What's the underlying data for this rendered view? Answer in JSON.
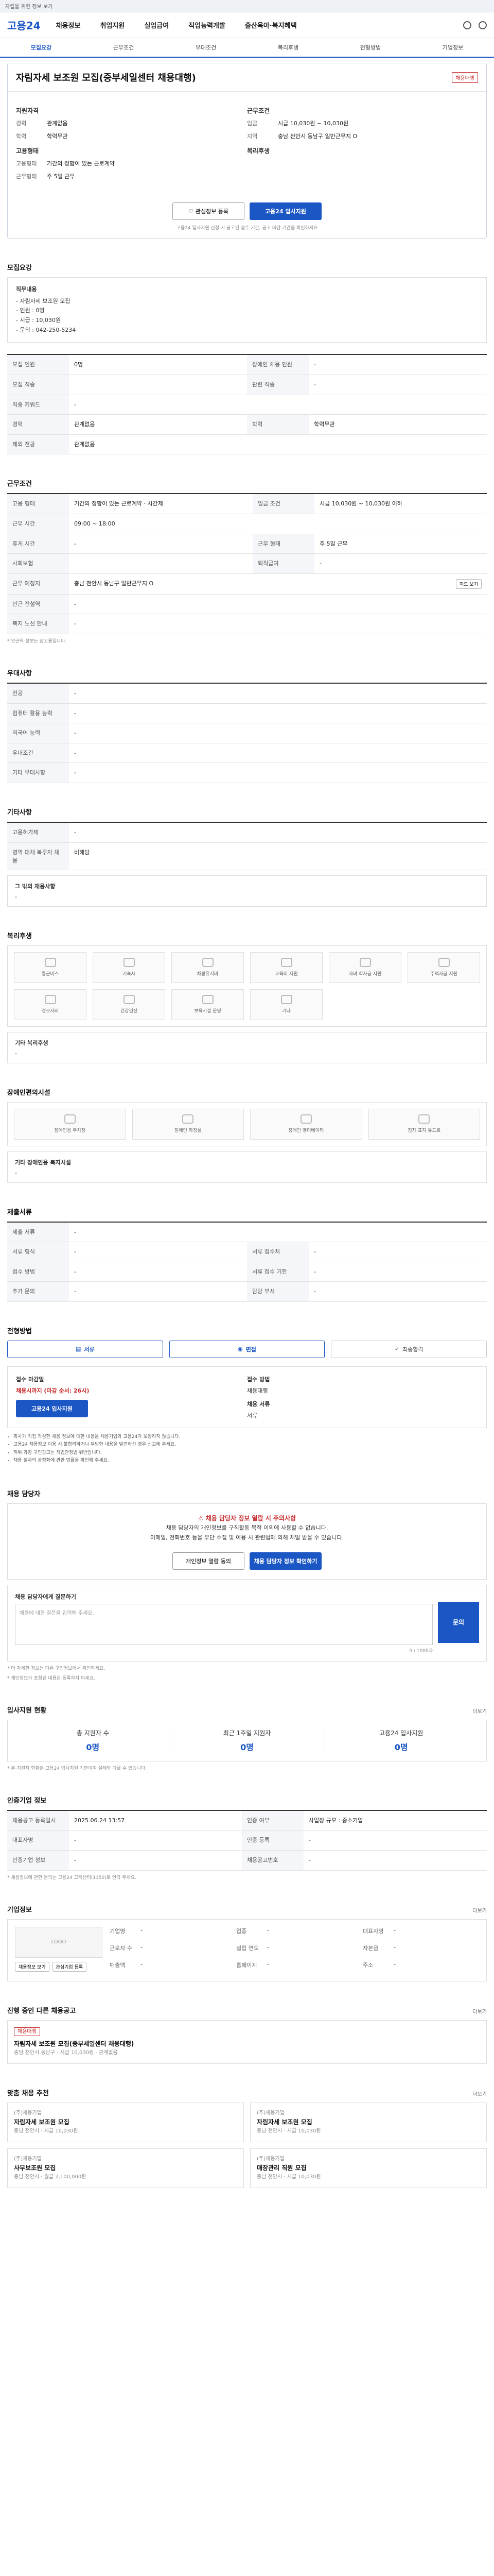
{
  "top_strip": "자립을 위한 정보 보기",
  "gnb": {
    "logo": "고용24",
    "items": [
      "채용정보",
      "취업지원",
      "실업급여",
      "직업능력개발",
      "출산육아·복지혜택"
    ]
  },
  "subtabs": [
    "모집요강",
    "근무조건",
    "우대조건",
    "복리후생",
    "전형방법",
    "기업정보"
  ],
  "job": {
    "title": "자림자세 보조원 모집(중부세일센터 채용대행)",
    "badge": "채용대행",
    "left_h1": "지원자격",
    "left_rows": [
      {
        "k": "경력",
        "v": "관계없음"
      },
      {
        "k": "학력",
        "v": "학력무관"
      }
    ],
    "left_h2": "고용형태",
    "left_rows2": [
      {
        "k": "고용형태",
        "v": "기간의 정함이 있는 근로계약"
      },
      {
        "k": "근무형태",
        "v": "주 5일 근무"
      }
    ],
    "right_h1": "근무조건",
    "right_rows": [
      {
        "k": "임금",
        "v": "시급 10,030원 ~ 10,030원"
      },
      {
        "k": "지역",
        "v": "충남 천안시 동남구 일반근무지 O"
      }
    ],
    "right_h2": "복리후생",
    "btn_scrap": "관심정보 등록",
    "btn_apply": "고용24 입사지원",
    "note": "고용24 입사지원 신청 시 공고된 접수 기간, 공고 마감 기간을 확인하세요"
  },
  "recruit": {
    "title": "모집요강",
    "duty_title": "직무내용",
    "duty_lines": [
      "- 자림자세 보조원 모집",
      "- 인원 : 0명",
      "- 시급 : 10,030원",
      "- 문의 : 042-250-5234"
    ],
    "rows": [
      {
        "k": "모집 인원",
        "v": "0명",
        "k2": "장애인 채용 인원",
        "v2": "-"
      },
      {
        "k": "모집 직종",
        "v": "",
        "k2": "관련 직종",
        "v2": "-"
      },
      {
        "k": "직종 키워드",
        "v": "-",
        "k2": "",
        "v2": ""
      },
      {
        "k": "경력",
        "v": "관계없음",
        "k2": "학력",
        "v2": "학력무관"
      },
      {
        "k": "제외 전공",
        "v": "관계없음",
        "k2": "",
        "v2": ""
      }
    ]
  },
  "work": {
    "title": "근무조건",
    "rows": [
      {
        "k": "고용 형태",
        "v": "기간의 정함이 있는 근로계약 · 시간제",
        "k2": "임금 조건",
        "v2": "시급 10,030원 ~ 10,030원 이하"
      },
      {
        "k": "근무 시간",
        "v": "09:00 ~ 18:00",
        "k2": "",
        "v2": ""
      },
      {
        "k": "휴게 시간",
        "v": "-",
        "k2": "근무 형태",
        "v2": "주 5일 근무"
      },
      {
        "k": "사회보험",
        "v": "",
        "k2": "퇴직급여",
        "v2": "-"
      },
      {
        "k": "근무 예정지",
        "v": "충남 천안시 동남구 일반근무지 O",
        "k2": "",
        "v2": ""
      },
      {
        "k": "인근 전철역",
        "v": "-",
        "k2": "",
        "v2": ""
      },
      {
        "k": "복지 노선 안내",
        "v": "-",
        "k2": "",
        "v2": ""
      }
    ],
    "map_btn": "지도 보기",
    "note": "* 인근역 정보는 참고용입니다."
  },
  "pref": {
    "title": "우대사항",
    "rows": [
      {
        "k": "전공",
        "v": "-"
      },
      {
        "k": "컴퓨터 활용 능력",
        "v": "-"
      },
      {
        "k": "외국어 능력",
        "v": "-"
      },
      {
        "k": "우대조건",
        "v": "-"
      },
      {
        "k": "기타 우대사항",
        "v": "-"
      }
    ]
  },
  "misc": {
    "title": "기타사항",
    "rows": [
      {
        "k": "고용허가제",
        "v": "-"
      },
      {
        "k": "병역 대체 복무자 채용",
        "v": "비해당"
      }
    ],
    "extra_title": "그 밖의 채용사항",
    "extra_value": "-"
  },
  "welfare": {
    "title": "복리후생",
    "items": [
      "통근버스",
      "기숙사",
      "차량유지비",
      "교육비 지원",
      "자녀 학자금 지원",
      "주택자금 지원",
      "경조사비",
      "건강검진",
      "보육시설 운영",
      "기타"
    ],
    "extra_title": "기타 복리후생",
    "extra_value": "-"
  },
  "access": {
    "title": "장애인편의시설",
    "items": [
      "장애인용 주차장",
      "장애인 화장실",
      "장애인 엘리베이터",
      "점자 표지 유도로"
    ],
    "extra_title": "기타 장애인용 복지시설",
    "extra_value": "-"
  },
  "prep": {
    "title": "제출서류",
    "rows": [
      {
        "k": "제출 서류",
        "v": "-",
        "k2": "",
        "v2": ""
      },
      {
        "k": "서류 형식",
        "v": "-",
        "k2": "서류 접수처",
        "v2": "-"
      },
      {
        "k": "접수 방법",
        "v": "-",
        "k2": "서류 접수 기한",
        "v2": "-"
      },
      {
        "k": "추가 문의",
        "v": "-",
        "k2": "담당 부서",
        "v2": "-"
      }
    ]
  },
  "process": {
    "title": "전형방법",
    "steps": [
      "서류",
      "면접",
      "최종합격"
    ]
  },
  "apply": {
    "left_label": "접수 마감일",
    "left_red": "채용시까지 (마감 순서: 26시)",
    "left_btn": "고용24 입사지원",
    "right_label": "접수 방법",
    "right_value": "채용대행",
    "right_label2": "채용 서류",
    "right_value2": "서류",
    "bullets": [
      "회사가 직접 작성한 채용 정보에 대한 내용을 채용기업과 고용24가 보장하지 않습니다.",
      "고용24 채용정보 이용 시 불합리하거나 부당한 내용을 발견하신 경우 신고해 주세요.",
      "허위·과장 구인광고는 직업안정법 위반입니다.",
      "채용 절차의 공정화에 관한 법률을 확인해 주세요."
    ]
  },
  "manager": {
    "title": "채용 담당자",
    "warn": "채용 담당자 정보 열람 시 주의사항",
    "line1": "채용 담당자의 개인정보를 구직활동 목적 이외에 사용할 수 없습니다.",
    "line2": "이메일, 전화번호 등을 무단 수집 및 이용 시 관련법에 의해 처벌 받을 수 있습니다.",
    "btn_view": "개인정보 열람 동의",
    "btn_show": "채용 담당자 정보 확인하기",
    "inq_title": "채용 담당자에게 질문하기",
    "inq_placeholder": "채용에 대한 질문을 입력해 주세요.",
    "inq_count": "0 / 1000자",
    "inq_btn": "문의",
    "inq_notes": [
      "* 더 자세한 정보는 다른 구인정보에서 확인하세요.",
      "* 개인정보가 포함된 내용은 등록하지 마세요."
    ]
  },
  "stats": {
    "title": "입사지원 현황",
    "more": "더보기",
    "items": [
      {
        "k": "총 지원자 수",
        "v": "0명"
      },
      {
        "k": "최근 1주일 지원자",
        "v": "0명"
      },
      {
        "k": "고용24 입사지원",
        "v": "0명"
      }
    ],
    "note": "* 본 지원자 현황은 고용24 입사지원 기준이며 실제와 다를 수 있습니다."
  },
  "info": {
    "title": "인증기업 정보",
    "rows": [
      {
        "k": "채용공고 등록일시",
        "v": "2025.06.24 13:57",
        "k2": "인증 여부",
        "v2": "사업장 규모 : 중소기업"
      },
      {
        "k": "대표자명",
        "v": "-",
        "k2": "인증 등록",
        "v2": "-"
      },
      {
        "k": "인증기업 정보",
        "v": "-",
        "k2": "채용공고번호",
        "v2": "-"
      }
    ],
    "note": "* 채용정보에 관한 문의는 고용24 고객센터(1350)로 연락 주세요."
  },
  "company": {
    "title": "기업정보",
    "more": "더보기",
    "logo_text": "LOGO",
    "rows": [
      {
        "k": "기업명",
        "v": "-"
      },
      {
        "k": "업종",
        "v": "-"
      },
      {
        "k": "대표자명",
        "v": "-"
      },
      {
        "k": "근로자 수",
        "v": "-"
      },
      {
        "k": "설립 연도",
        "v": "-"
      },
      {
        "k": "자본금",
        "v": "-"
      },
      {
        "k": "매출액",
        "v": "-"
      },
      {
        "k": "홈페이지",
        "v": "-"
      },
      {
        "k": "주소",
        "v": "-"
      }
    ],
    "btn_map": "채용정보 보기",
    "btn_follow": "관심기업 등록"
  },
  "ongoing": {
    "title": "진행 중인 다른 채용공고",
    "more": "더보기",
    "card_badge": "채용대행",
    "card_title": "자림자세 보조원 모집(중부세일센터 채용대행)",
    "card_meta": "충남 천안시 동남구 · 시급 10,030원 · 관계없음"
  },
  "recommend": {
    "title": "맞춤 채용 추천",
    "more": "더보기",
    "cards": [
      {
        "c": "(주)채용기업",
        "t": "자림자세 보조원 모집",
        "m": "충남 천안시 · 시급 10,030원"
      },
      {
        "c": "(주)채용기업",
        "t": "자림자세 보조원 모집",
        "m": "충남 천안시 · 시급 10,030원"
      },
      {
        "c": "(주)채용기업",
        "t": "사무보조원 모집",
        "m": "충남 천안시 · 월급 2,100,000원"
      },
      {
        "c": "(주)채용기업",
        "t": "매장관리 직원 모집",
        "m": "충남 천안시 · 시급 10,030원"
      }
    ]
  }
}
